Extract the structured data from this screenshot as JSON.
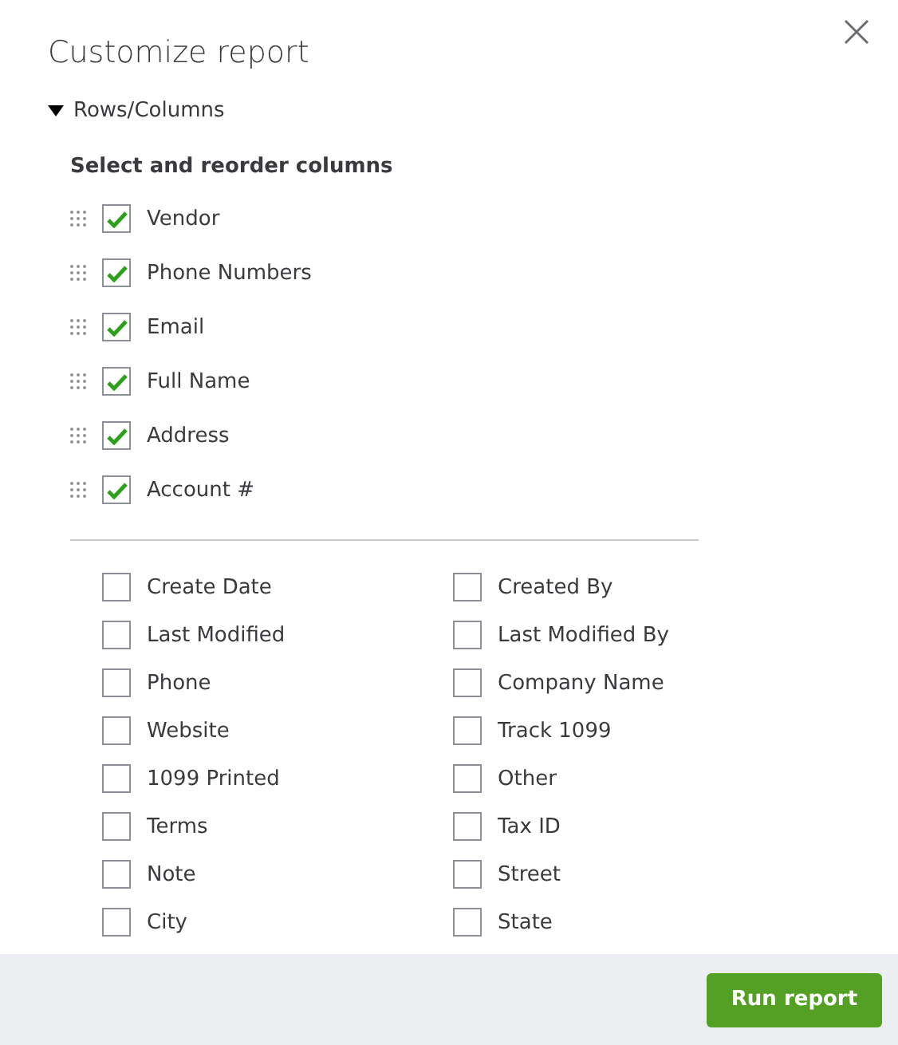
{
  "dialog": {
    "title": "Customize report"
  },
  "section": {
    "label": "Rows/Columns",
    "expanded": true
  },
  "heading": "Select and reorder columns",
  "selected_columns": [
    {
      "label": "Vendor",
      "checked": true
    },
    {
      "label": "Phone Numbers",
      "checked": true
    },
    {
      "label": "Email",
      "checked": true
    },
    {
      "label": "Full Name",
      "checked": true
    },
    {
      "label": "Address",
      "checked": true
    },
    {
      "label": "Account #",
      "checked": true
    }
  ],
  "other_columns": [
    {
      "label": "Create Date",
      "checked": false
    },
    {
      "label": "Created By",
      "checked": false
    },
    {
      "label": "Last Modified",
      "checked": false
    },
    {
      "label": "Last Modified By",
      "checked": false
    },
    {
      "label": "Phone",
      "checked": false
    },
    {
      "label": "Company Name",
      "checked": false
    },
    {
      "label": "Website",
      "checked": false
    },
    {
      "label": "Track 1099",
      "checked": false
    },
    {
      "label": "1099 Printed",
      "checked": false
    },
    {
      "label": "Other",
      "checked": false
    },
    {
      "label": "Terms",
      "checked": false
    },
    {
      "label": "Tax ID",
      "checked": false
    },
    {
      "label": "Note",
      "checked": false
    },
    {
      "label": "Street",
      "checked": false
    },
    {
      "label": "City",
      "checked": false
    },
    {
      "label": "State",
      "checked": false
    }
  ],
  "footer": {
    "button": "Run report"
  }
}
